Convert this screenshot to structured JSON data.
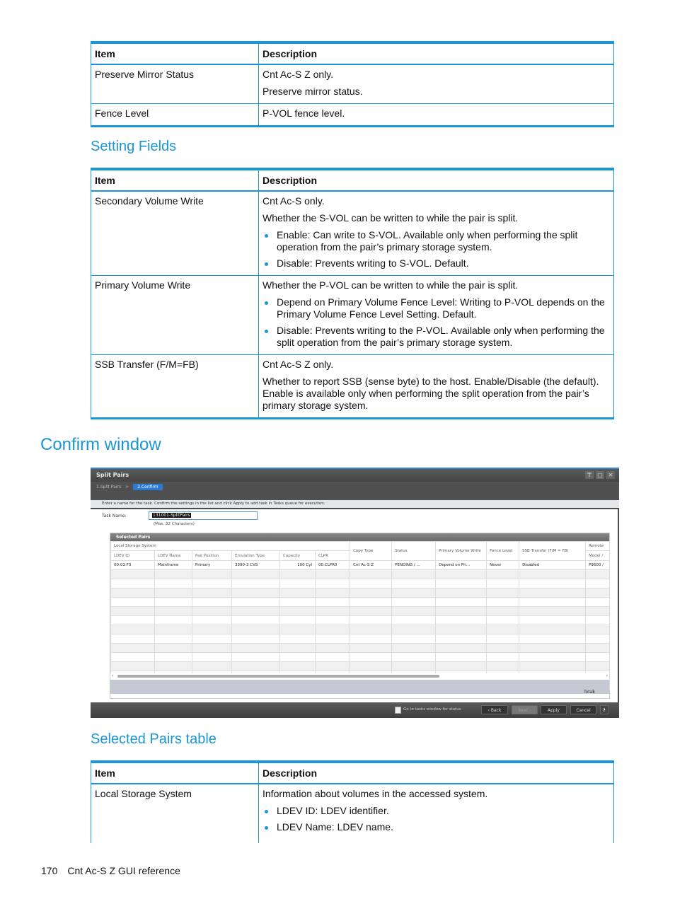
{
  "table1": {
    "headers": [
      "Item",
      "Description"
    ],
    "rows": [
      {
        "item": "Preserve Mirror Status",
        "paras": [
          "Cnt Ac-S Z only.",
          "Preserve mirror status."
        ]
      },
      {
        "item": "Fence Level",
        "paras": [
          "P-VOL fence level."
        ]
      }
    ]
  },
  "setting_fields": {
    "heading": "Setting Fields",
    "headers": [
      "Item",
      "Description"
    ],
    "rows": [
      {
        "item": "Secondary Volume Write",
        "paras": [
          "Cnt Ac-S only.",
          "Whether the S-VOL can be written to while the pair is split."
        ],
        "bullets": [
          "Enable: Can write to S-VOL. Available only when performing the split operation from the pair’s primary storage system.",
          "Disable: Prevents writing to S-VOL. Default."
        ]
      },
      {
        "item": "Primary Volume Write",
        "paras": [
          "Whether the P-VOL can be written to while the pair is split."
        ],
        "bullets": [
          "Depend on Primary Volume Fence Level: Writing to P-VOL depends on the Primary Volume Fence Level Setting. Default.",
          "Disable: Prevents writing to the P-VOL. Available only when performing the split operation from the pair’s primary storage system."
        ]
      },
      {
        "item": "SSB Transfer (F/M=FB)",
        "paras": [
          "Cnt Ac-S Z only.",
          "Whether to report SSB (sense byte) to the host. Enable/Disable (the default). Enable is available only when performing the split operation from the pair’s primary storage system."
        ]
      }
    ]
  },
  "confirm_window": {
    "heading": "Confirm window",
    "screenshot": {
      "title": "Split Pairs",
      "window_controls": [
        "pin",
        "maximize",
        "close"
      ],
      "steps": [
        "1.Split Pairs",
        ">",
        "2.Confirm"
      ],
      "instruction": "Enter a name for the task. Confirm the settings in the list and click Apply to add task in Tasks queue for execution.",
      "task_name_label": "Task Name:",
      "task_name_value": "131001-SplitPairs",
      "task_name_hint": "(Max. 32 Characters)",
      "panel_title": "Selected Pairs",
      "group_header": "Local Storage System",
      "remote_group_header": "Remote",
      "columns": [
        "LDEV ID",
        "LDEV Name",
        "Pair Position",
        "Emulation Type",
        "Capacity",
        "CLPR",
        "Copy Type",
        "Status",
        "Primary Volume Write",
        "Fence Level",
        "SSB Transfer (F/M = FB)",
        "Model /"
      ],
      "rows": [
        [
          "00:01:F3",
          "Mainframe",
          "Primary",
          "3390-3 CVS",
          "100 Cyl",
          "00:CLPR0",
          "Cnt Ac-S Z",
          "PENDING / ...",
          "Depend on Pri...",
          "Never",
          "Disabled",
          "P9500 /"
        ]
      ],
      "total_label": "Total:",
      "total_value": "1",
      "go_to_tasks_label": "Go to tasks window for status",
      "buttons": {
        "back": "‹ Back",
        "next": "Next ›",
        "apply": "Apply",
        "cancel": "Cancel",
        "help": "?"
      }
    }
  },
  "selected_pairs_table": {
    "heading": "Selected Pairs table",
    "headers": [
      "Item",
      "Description"
    ],
    "rows": [
      {
        "item": "Local Storage System",
        "paras": [
          "Information about volumes in the accessed system."
        ],
        "bullets": [
          "LDEV ID: LDEV identifier.",
          "LDEV Name: LDEV name."
        ]
      }
    ]
  },
  "footer": {
    "page_number": "170",
    "title": "Cnt Ac-S Z GUI reference"
  },
  "colors": {
    "accent": "#1a96d6"
  }
}
